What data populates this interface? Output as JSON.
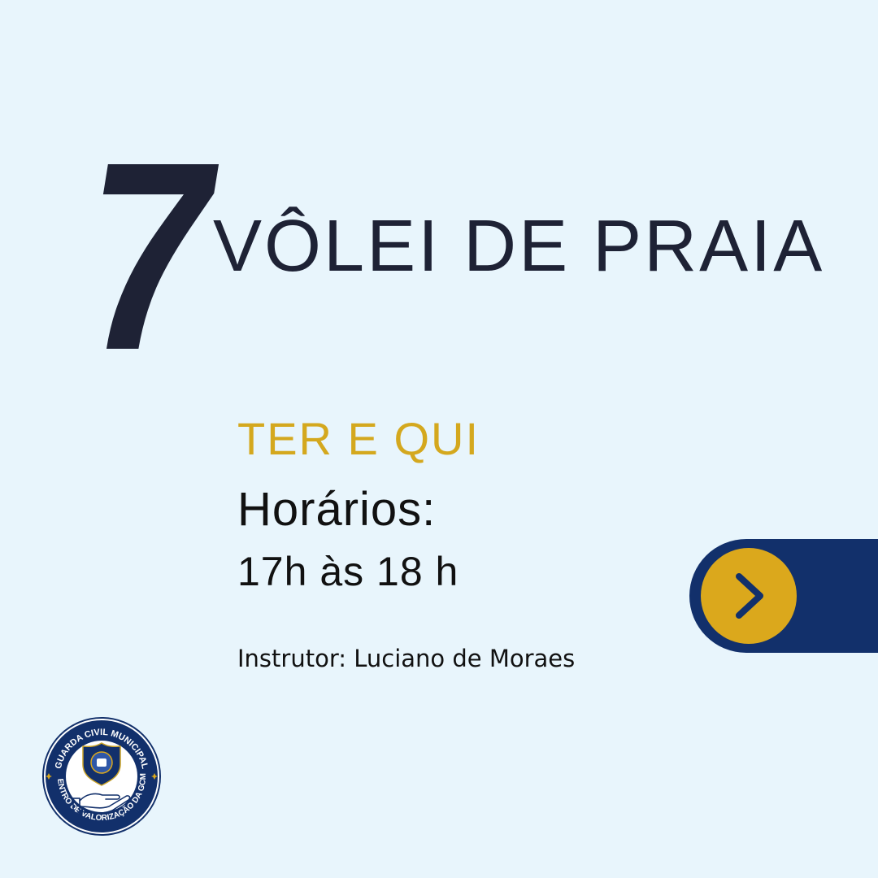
{
  "card": {
    "number": "7",
    "title": "VÔLEI DE PRAIA",
    "days": "TER E QUI",
    "hours_label": "Horários:",
    "hours_value": "17h às 18 h",
    "instructor": "Instrutor: Luciano de Moraes"
  },
  "next_button": {
    "icon": "chevron-right-icon"
  },
  "logo": {
    "top_text": "GUARDA CIVIL MUNICIPAL",
    "bottom_text": "CENTRO DE VALORIZAÇÃO DA GCM"
  },
  "colors": {
    "background": "#e8f5fc",
    "dark_text": "#1e2235",
    "gold": "#d4a81e",
    "navy": "#12306b"
  }
}
